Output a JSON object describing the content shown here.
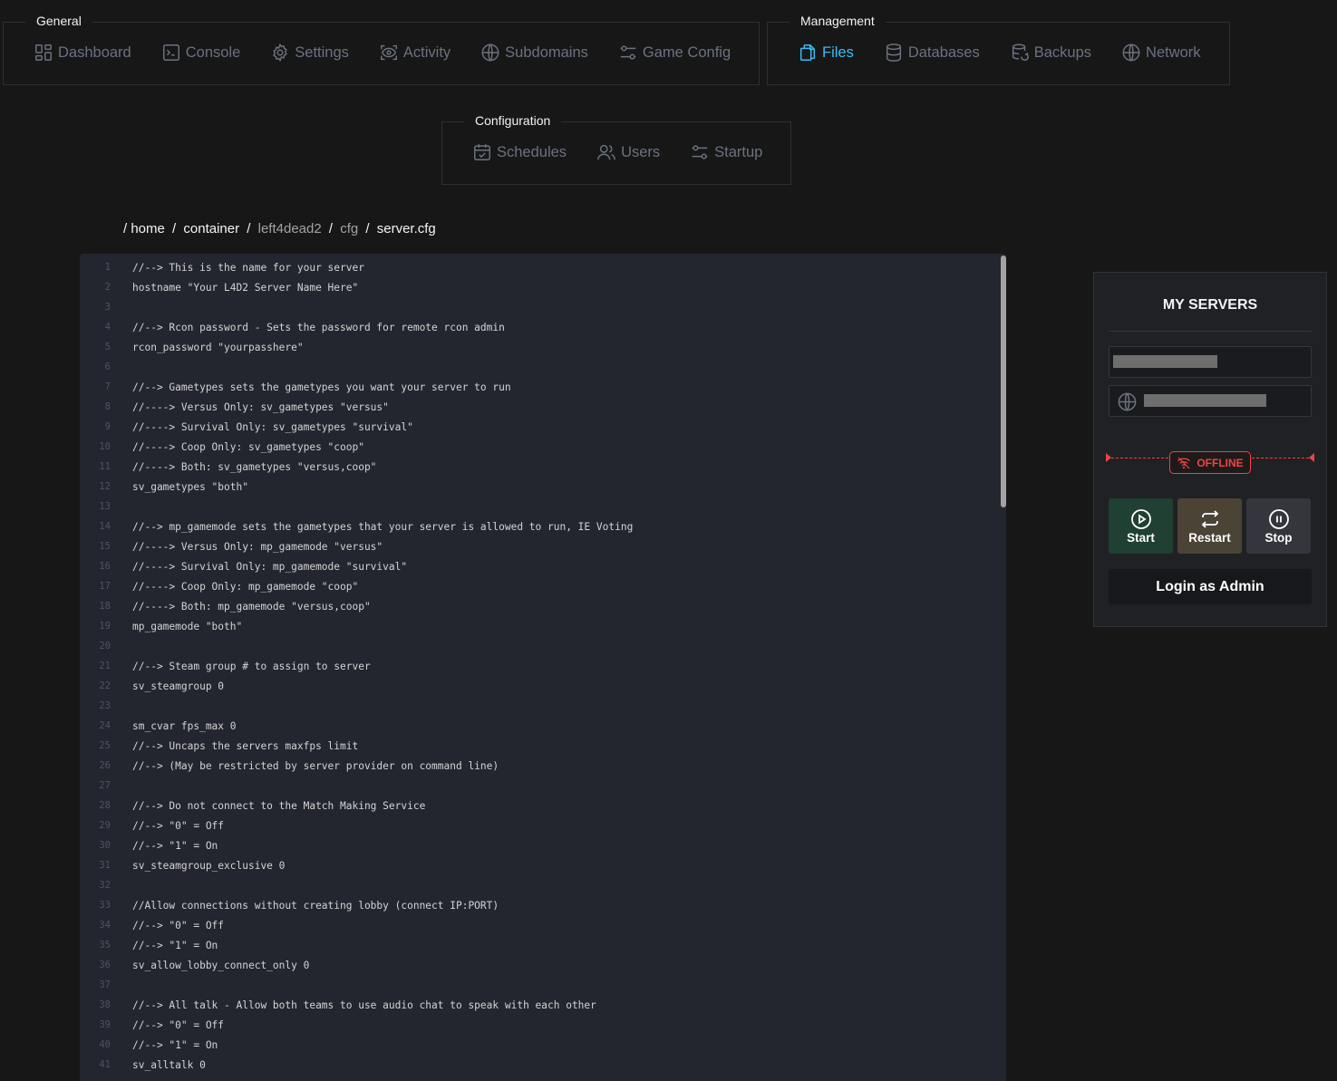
{
  "nav": {
    "general": {
      "title": "General",
      "items": [
        {
          "label": "Dashboard",
          "icon": "dashboard-icon"
        },
        {
          "label": "Console",
          "icon": "console-icon"
        },
        {
          "label": "Settings",
          "icon": "gear-icon"
        },
        {
          "label": "Activity",
          "icon": "activity-icon"
        },
        {
          "label": "Subdomains",
          "icon": "globe-icon"
        },
        {
          "label": "Game Config",
          "icon": "sliders-icon"
        }
      ]
    },
    "management": {
      "title": "Management",
      "items": [
        {
          "label": "Files",
          "icon": "files-icon",
          "active": true
        },
        {
          "label": "Databases",
          "icon": "database-icon"
        },
        {
          "label": "Backups",
          "icon": "backup-icon"
        },
        {
          "label": "Network",
          "icon": "globe-icon"
        }
      ]
    },
    "configuration": {
      "title": "Configuration",
      "items": [
        {
          "label": "Schedules",
          "icon": "calendar-icon"
        },
        {
          "label": "Users",
          "icon": "users-icon"
        },
        {
          "label": "Startup",
          "icon": "sliders-icon"
        }
      ]
    }
  },
  "breadcrumb": {
    "root": "/",
    "parts": [
      "home",
      "container",
      "left4dead2",
      "cfg",
      "server.cfg"
    ],
    "separator": "/"
  },
  "editor": {
    "lines": [
      "//--> This is the name for your server",
      "hostname \"Your L4D2 Server Name Here\"",
      "",
      "//--> Rcon password - Sets the password for remote rcon admin",
      "rcon_password \"yourpasshere\"",
      "",
      "//--> Gametypes sets the gametypes you want your server to run",
      "//----> Versus Only: sv_gametypes \"versus\"",
      "//----> Survival Only: sv_gametypes \"survival\"",
      "//----> Coop Only: sv_gametypes \"coop\"",
      "//----> Both: sv_gametypes \"versus,coop\"",
      "sv_gametypes \"both\"",
      "",
      "//--> mp_gamemode sets the gametypes that your server is allowed to run, IE Voting",
      "//----> Versus Only: mp_gamemode \"versus\"",
      "//----> Survival Only: mp_gamemode \"survival\"",
      "//----> Coop Only: mp_gamemode \"coop\"",
      "//----> Both: mp_gamemode \"versus,coop\"",
      "mp_gamemode \"both\"",
      "",
      "//--> Steam group # to assign to server",
      "sv_steamgroup 0",
      "",
      "sm_cvar fps_max 0",
      "//--> Uncaps the servers maxfps limit",
      "//--> (May be restricted by server provider on command line)",
      "",
      "//--> Do not connect to the Match Making Service",
      "//--> \"0\" = Off",
      "//--> \"1\" = On",
      "sv_steamgroup_exclusive 0",
      "",
      "//Allow connections without creating lobby (connect IP:PORT)",
      "//--> \"0\" = Off",
      "//--> \"1\" = On",
      "sv_allow_lobby_connect_only 0",
      "",
      "//--> All talk - Allow both teams to use audio chat to speak with each other",
      "//--> \"0\" = Off",
      "//--> \"1\" = On",
      "sv_alltalk 0"
    ]
  },
  "servers": {
    "title": "MY SERVERS",
    "status": "OFFLINE",
    "buttons": {
      "start": "Start",
      "restart": "Restart",
      "stop": "Stop"
    },
    "login_label": "Login as Admin"
  },
  "colors": {
    "background": "#171717",
    "accent": "#38bdf8",
    "offline": "#ef4444",
    "start": "#1f4032",
    "restart": "#4a4336",
    "stop": "#35363d"
  }
}
